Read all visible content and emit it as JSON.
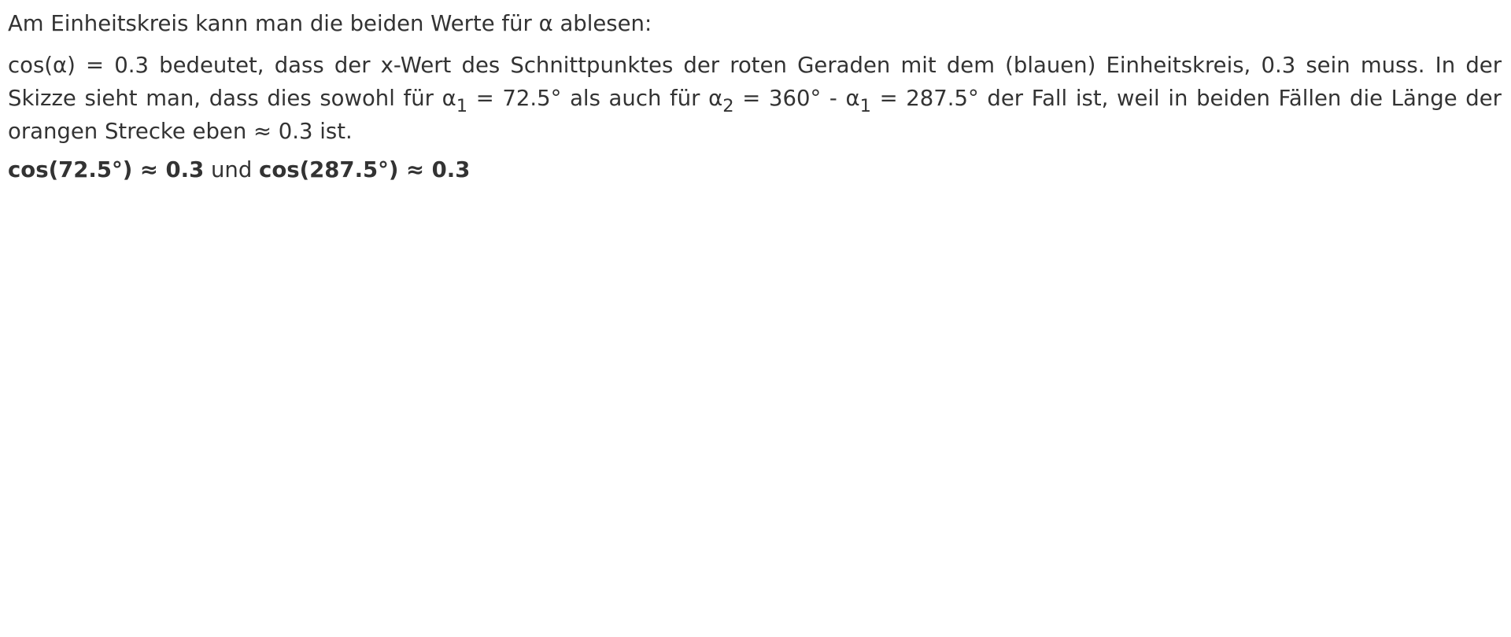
{
  "intro": "Am Einheitskreis kann man die beiden Werte für α ablesen:",
  "explanation": {
    "part1": "cos(α) = 0.3 bedeutet, dass der x-Wert des Schnittpunktes der roten Geraden mit dem (blauen) Einheitskreis, 0.3 sein muss. In der Skizze sieht man, dass dies sowohl für α",
    "sub1": "1",
    "part2": " = 72.5° als auch für α",
    "sub2": "2",
    "part3": " = 360° - α",
    "sub3": "1",
    "part4": " = 287.5° der Fall ist, weil in beiden Fällen die Länge der orangen Strecke eben ≈ 0.3 ist."
  },
  "result": {
    "first": "cos(72.5°) ≈ 0.3",
    "connector": " und ",
    "second": "cos(287.5°) ≈ 0.3"
  }
}
